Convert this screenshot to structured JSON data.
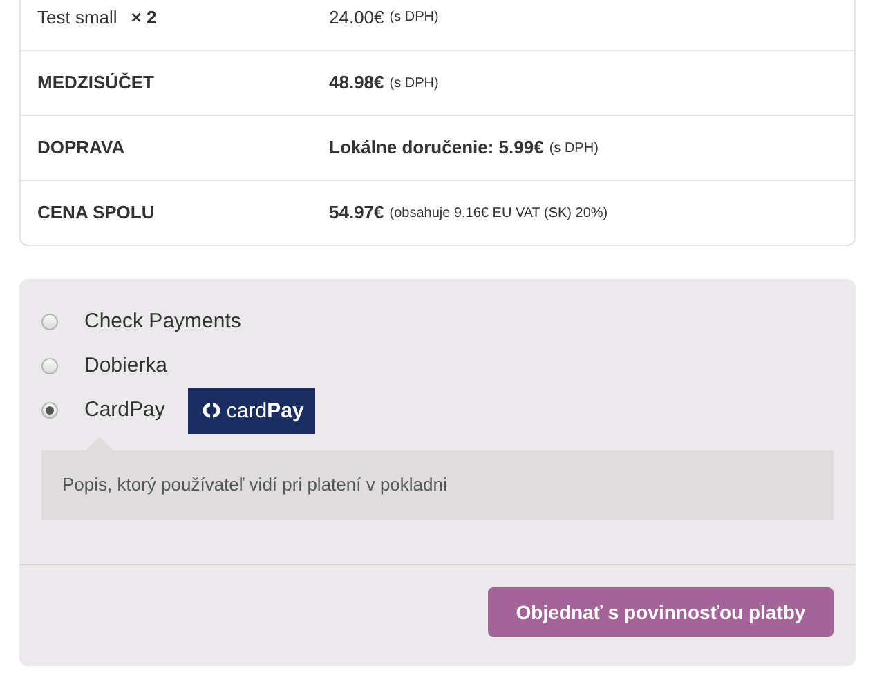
{
  "order_table": {
    "rows": [
      {
        "kind": "item",
        "label": "Test small",
        "quantity": "× 2",
        "value": "24.00€",
        "note": "(s DPH)"
      },
      {
        "kind": "total",
        "label": "MEDZISÚČET",
        "value": "48.98€",
        "note": "(s DPH)"
      },
      {
        "kind": "total",
        "label": "DOPRAVA",
        "value": "Lokálne doručenie: 5.99€",
        "note": "(s DPH)"
      },
      {
        "kind": "total",
        "label": "CENA SPOLU",
        "value": "54.97€",
        "note": "(obsahuje 9.16€ EU VAT (SK) 20%)"
      }
    ]
  },
  "payment": {
    "methods": [
      {
        "label": "Check Payments",
        "selected": false
      },
      {
        "label": "Dobierka",
        "selected": false
      },
      {
        "label": "CardPay",
        "selected": true,
        "logo": {
          "text": "card",
          "bold_text": "Pay"
        }
      }
    ],
    "description": "Popis, ktorý používateľ vidí pri platení v pokladni",
    "button": "Objednať s povinnosťou platby"
  }
}
